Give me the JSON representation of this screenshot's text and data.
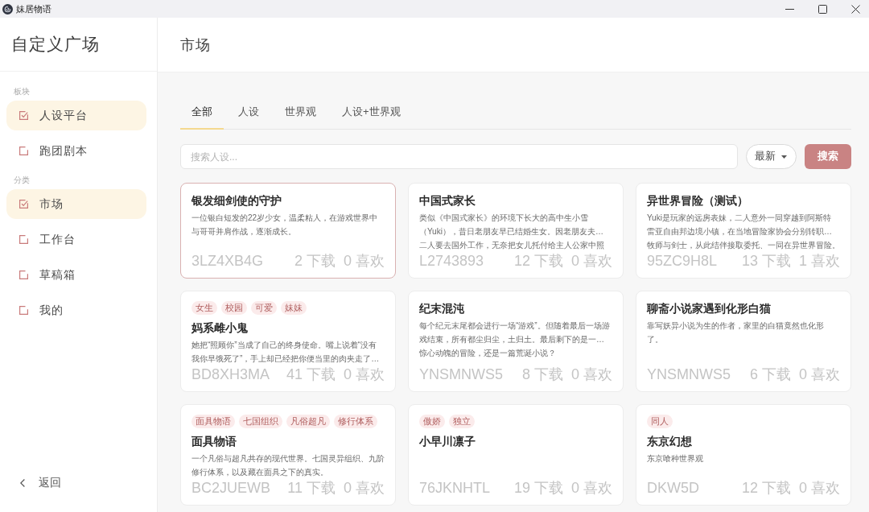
{
  "window": {
    "title": "妹居物语"
  },
  "sidebar": {
    "title": "自定义广场",
    "sections": [
      {
        "label": "板块",
        "items": [
          {
            "label": "人设平台",
            "selected": true
          },
          {
            "label": "跑团剧本",
            "selected": false
          }
        ]
      },
      {
        "label": "分类",
        "items": [
          {
            "label": "市场",
            "selected": true
          },
          {
            "label": "工作台",
            "selected": false
          },
          {
            "label": "草稿箱",
            "selected": false
          },
          {
            "label": "我的",
            "selected": false
          }
        ]
      }
    ],
    "back": "返回"
  },
  "main": {
    "title": "市场",
    "tabs": [
      {
        "label": "全部",
        "selected": true
      },
      {
        "label": "人设",
        "selected": false
      },
      {
        "label": "世界观",
        "selected": false
      },
      {
        "label": "人设+世界观",
        "selected": false
      }
    ],
    "search": {
      "placeholder": "搜索人设..."
    },
    "sort": {
      "value": "最新"
    },
    "search_button": "搜索",
    "cards": [
      {
        "title": "银发细剑使的守护",
        "description_lines": [
          "一位银白短发的22岁少女，温柔粘人，在游戏世界中",
          "与哥哥并肩作战，逐渐成长。"
        ],
        "code": "3LZ4XB4G",
        "downloads": "2 下载",
        "likes": "0 喜欢",
        "selected": true
      },
      {
        "title": "中国式家长",
        "description_lines": [
          "类似《中国式家长》的环境下长大的高中生小雪",
          "（Yuki），昔日老朋友早已结婚生女。因老朋友夫…",
          "二人要去国外工作，无奈把女儿托付给主人公家中照"
        ],
        "code": "L2743893",
        "downloads": "12 下载",
        "likes": "0 喜欢",
        "selected": false
      },
      {
        "title": "异世界冒险（测试）",
        "description_lines": [
          "Yuki是玩家的远房表妹，二人意外一同穿越到阿斯特",
          "雷亚自由邦边境小镇，在当地冒险家协会分别转职…",
          "牧师与剑士，从此结伴接取委托、一同在异世界冒险。"
        ],
        "code": "95ZC9H8L",
        "downloads": "13 下载",
        "likes": "1 喜欢",
        "selected": false
      },
      {
        "tags": [
          "女生",
          "校园",
          "可爱",
          "妹妹"
        ],
        "title": "妈系雌小鬼",
        "description_lines": [
          "她把“照顾你”当成了自己的终身使命。嘴上说着“没有",
          "我你早饿死了”，手上却已经把你便当里的肉夹走了…"
        ],
        "code": "BD8XH3MA",
        "downloads": "41 下载",
        "likes": "0 喜欢",
        "selected": false
      },
      {
        "title": "纪末混沌",
        "description_lines": [
          "每个纪元末尾都会进行一场“游戏”。但随着最后一场游",
          "戏结束，所有都尘归尘，土归土。最后剩下的是一…",
          "惊心动魄的冒险，还是一篇荒诞小说？"
        ],
        "code": "YNSMNWS5",
        "downloads": "8 下载",
        "likes": "0 喜欢",
        "selected": false
      },
      {
        "title": "聊斋小说家遇到化形白猫",
        "description_lines": [
          "靠写妖异小说为生的作者，家里的白猫竟然也化形",
          "了。"
        ],
        "code": "YNSMNWS5",
        "downloads": "6 下载",
        "likes": "0 喜欢",
        "selected": false
      },
      {
        "tags": [
          "面具物语",
          "七国组织",
          "凡俗超凡",
          "修行体系"
        ],
        "title": "面具物语",
        "description_lines": [
          "一个凡俗与超凡共存的现代世界。七国灵异组织、九阶",
          "修行体系，以及藏在面具之下的真实。"
        ],
        "code": "BC2JUEWB",
        "downloads": "11 下载",
        "likes": "0 喜欢",
        "selected": false
      },
      {
        "tags": [
          "傲娇",
          "独立"
        ],
        "title": "小早川凛子",
        "code": "76JKNHTL",
        "downloads": "19 下载",
        "likes": "0 喜欢",
        "selected": false
      },
      {
        "tags": [
          "同人"
        ],
        "title": "东京幻想",
        "description_lines": [
          "东京喰种世界观"
        ],
        "code": "DKW5D",
        "downloads": "12 下载",
        "likes": "0 喜欢",
        "selected": false
      }
    ]
  }
}
